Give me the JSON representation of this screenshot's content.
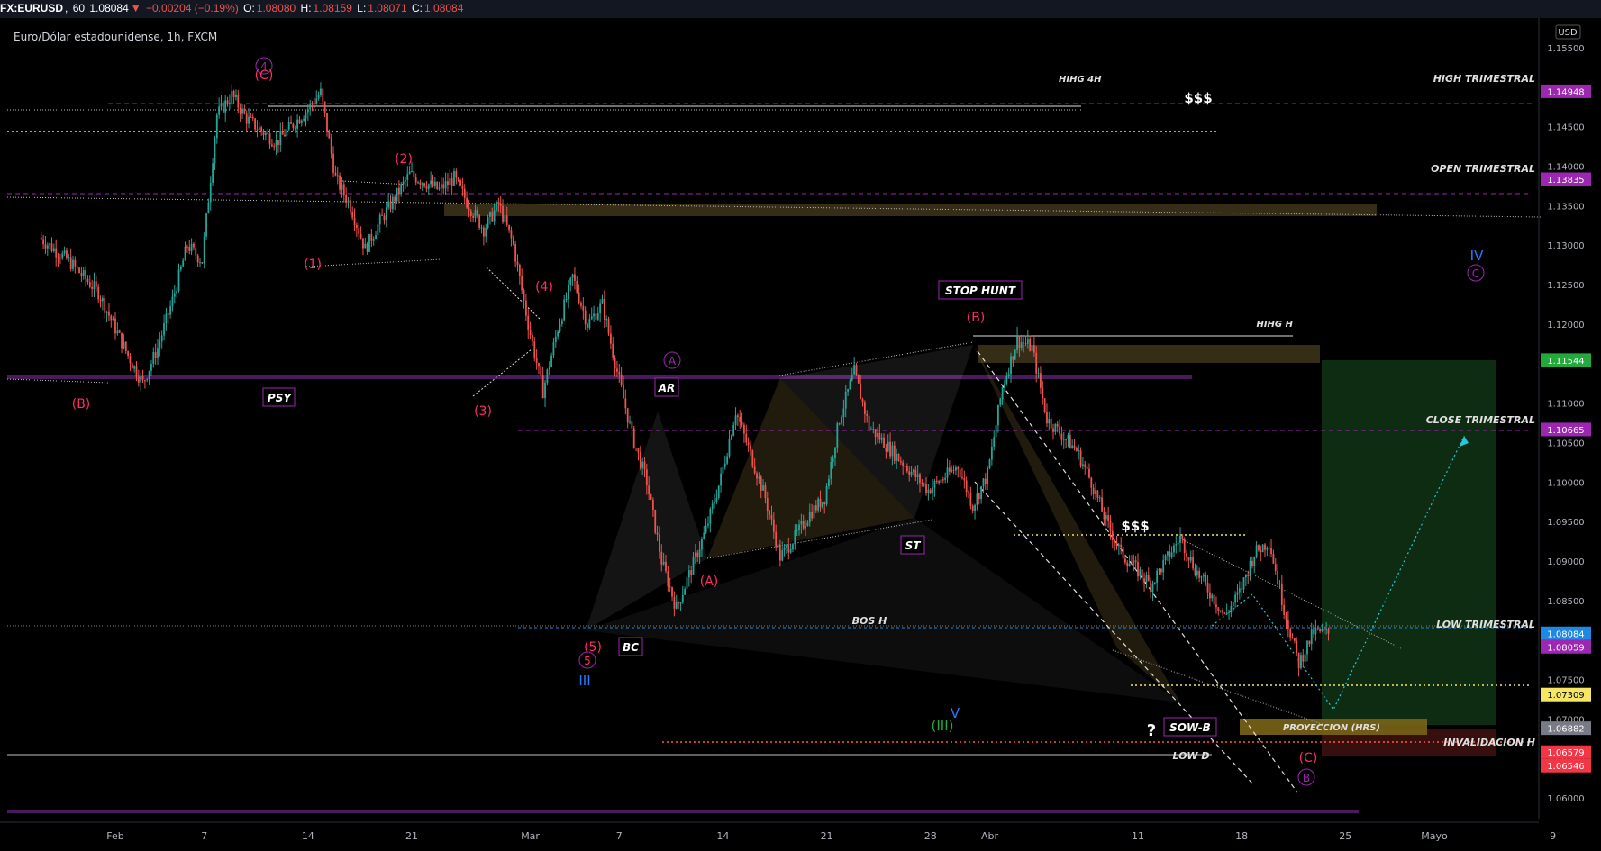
{
  "header": {
    "symbol": "FX:EURUSD",
    "interval": "60",
    "last": "1.08084",
    "change": "−0.00204 (−0.19%)",
    "o_label": "O:",
    "o": "1.08080",
    "h_label": "H:",
    "h": "1.08159",
    "l_label": "L:",
    "l": "1.08071",
    "c_label": "C:",
    "c": "1.08084",
    "subtitle": "Euro/Dólar estadounidense, 1h, FXCM",
    "currency": "USD"
  },
  "colors": {
    "up": "#26a69a",
    "down": "#ef5350",
    "magenta": "#9c27b0",
    "wave_red": "#ff2e63",
    "yellow": "#f5e663",
    "white": "#e0e0e0",
    "bg": "#000000",
    "axis_bg": "#000000"
  },
  "chart_data": {
    "type": "candlestick",
    "title": "Euro/Dólar estadounidense, 1h, FXCM",
    "y_axis": {
      "range": [
        1.055,
        1.158
      ],
      "ticks": [
        "1.15500",
        "1.15000",
        "1.14500",
        "1.14000",
        "1.13500",
        "1.13000",
        "1.12500",
        "1.12000",
        "1.11500",
        "1.11000",
        "1.10500",
        "1.10000",
        "1.09500",
        "1.09000",
        "1.08500",
        "1.08000",
        "1.07500",
        "1.07000",
        "1.06500",
        "1.06000"
      ],
      "tick_values": [
        1.155,
        1.15,
        1.145,
        1.14,
        1.135,
        1.13,
        1.125,
        1.12,
        1.115,
        1.11,
        1.105,
        1.1,
        1.095,
        1.09,
        1.085,
        1.08,
        1.075,
        1.07,
        1.065,
        1.06
      ]
    },
    "x_axis": {
      "range": [
        "2025-01-27",
        "2025-05-10"
      ],
      "ticks": [
        {
          "label": "Feb",
          "date": "2025-02-01"
        },
        {
          "label": "7",
          "date": "2025-02-07"
        },
        {
          "label": "14",
          "date": "2025-02-14"
        },
        {
          "label": "21",
          "date": "2025-02-21"
        },
        {
          "label": "Mar",
          "date": "2025-03-01"
        },
        {
          "label": "7",
          "date": "2025-03-07"
        },
        {
          "label": "14",
          "date": "2025-03-14"
        },
        {
          "label": "21",
          "date": "2025-03-21"
        },
        {
          "label": "28",
          "date": "2025-03-28"
        },
        {
          "label": "Abr",
          "date": "2025-04-01"
        },
        {
          "label": "11",
          "date": "2025-04-11"
        },
        {
          "label": "18",
          "date": "2025-04-18"
        },
        {
          "label": "25",
          "date": "2025-04-25"
        },
        {
          "label": "Mayo",
          "date": "2025-05-01"
        },
        {
          "label": "9",
          "date": "2025-05-09"
        }
      ]
    },
    "price_path": [
      [
        "2025-01-27",
        1.131
      ],
      [
        "2025-01-29",
        1.128
      ],
      [
        "2025-01-31",
        1.124
      ],
      [
        "2025-02-02",
        1.116
      ],
      [
        "2025-02-03",
        1.1125
      ],
      [
        "2025-02-04",
        1.117
      ],
      [
        "2025-02-05",
        1.123
      ],
      [
        "2025-02-06",
        1.13
      ],
      [
        "2025-02-07",
        1.128
      ],
      [
        "2025-02-08",
        1.1465
      ],
      [
        "2025-02-09",
        1.149
      ],
      [
        "2025-02-10",
        1.146
      ],
      [
        "2025-02-12",
        1.143
      ],
      [
        "2025-02-14",
        1.147
      ],
      [
        "2025-02-15",
        1.1493
      ],
      [
        "2025-02-16",
        1.1385
      ],
      [
        "2025-02-17",
        1.135
      ],
      [
        "2025-02-18",
        1.1295
      ],
      [
        "2025-02-19",
        1.133
      ],
      [
        "2025-02-21",
        1.139
      ],
      [
        "2025-02-23",
        1.137
      ],
      [
        "2025-02-24",
        1.1385
      ],
      [
        "2025-02-25",
        1.135
      ],
      [
        "2025-02-26",
        1.132
      ],
      [
        "2025-02-27",
        1.1352
      ],
      [
        "2025-02-28",
        1.13
      ],
      [
        "2025-03-01",
        1.12
      ],
      [
        "2025-03-02",
        1.1115
      ],
      [
        "2025-03-03",
        1.1195
      ],
      [
        "2025-03-04",
        1.126
      ],
      [
        "2025-03-05",
        1.12
      ],
      [
        "2025-03-06",
        1.1225
      ],
      [
        "2025-03-07",
        1.114
      ],
      [
        "2025-03-08",
        1.106
      ],
      [
        "2025-03-09",
        1.1
      ],
      [
        "2025-03-10",
        1.09
      ],
      [
        "2025-03-11",
        1.084
      ],
      [
        "2025-03-12",
        1.089
      ],
      [
        "2025-03-13",
        1.094
      ],
      [
        "2025-03-14",
        1.1005
      ],
      [
        "2025-03-15",
        1.109
      ],
      [
        "2025-03-16",
        1.1035
      ],
      [
        "2025-03-17",
        1.098
      ],
      [
        "2025-03-18",
        1.0905
      ],
      [
        "2025-03-19",
        1.093
      ],
      [
        "2025-03-20",
        1.096
      ],
      [
        "2025-03-21",
        1.098
      ],
      [
        "2025-03-22",
        1.108
      ],
      [
        "2025-03-23",
        1.114
      ],
      [
        "2025-03-24",
        1.107
      ],
      [
        "2025-03-26",
        1.103
      ],
      [
        "2025-03-28",
        1.099
      ],
      [
        "2025-03-30",
        1.102
      ],
      [
        "2025-03-31",
        1.097
      ],
      [
        "2025-04-01",
        1.101
      ],
      [
        "2025-04-02",
        1.112
      ],
      [
        "2025-04-03",
        1.118
      ],
      [
        "2025-04-04",
        1.117
      ],
      [
        "2025-04-05",
        1.108
      ],
      [
        "2025-04-07",
        1.104
      ],
      [
        "2025-04-08",
        1.1
      ],
      [
        "2025-04-09",
        1.095
      ],
      [
        "2025-04-10",
        1.091
      ],
      [
        "2025-04-12",
        1.087
      ],
      [
        "2025-04-14",
        1.093
      ],
      [
        "2025-04-15",
        1.089
      ],
      [
        "2025-04-16",
        1.086
      ],
      [
        "2025-04-17",
        1.083
      ],
      [
        "2025-04-18",
        1.086
      ],
      [
        "2025-04-19",
        1.091
      ],
      [
        "2025-04-20",
        1.0925
      ],
      [
        "2025-04-21",
        1.084
      ],
      [
        "2025-04-22",
        1.077
      ],
      [
        "2025-04-23",
        1.081
      ],
      [
        "2025-04-24",
        1.0808
      ]
    ],
    "price_labels": [
      {
        "text": "1.14948",
        "value": 1.14948,
        "bg": "#9c27b0",
        "fg": "#ffffff"
      },
      {
        "text": "1.13835",
        "value": 1.13835,
        "bg": "#9c27b0",
        "fg": "#ffffff"
      },
      {
        "text": "1.11544",
        "value": 1.11544,
        "bg": "#22ab3a",
        "fg": "#ffffff"
      },
      {
        "text": "1.10665",
        "value": 1.10665,
        "bg": "#9c27b0",
        "fg": "#ffffff"
      },
      {
        "text": "1.08084",
        "value": 1.08084,
        "bg": "#1e88e5",
        "fg": "#ffffff"
      },
      {
        "text": "1.08059",
        "value": 1.08059,
        "bg": "#9c27b0",
        "fg": "#ffffff"
      },
      {
        "text": "1.07309",
        "value": 1.07309,
        "bg": "#f5e663",
        "fg": "#000000"
      },
      {
        "text": "1.06882",
        "value": 1.06882,
        "bg": "#787b86",
        "fg": "#ffffff"
      },
      {
        "text": "1.06579",
        "value": 1.06579,
        "bg": "#f23645",
        "fg": "#ffffff"
      },
      {
        "text": "1.06546",
        "value": 1.06546,
        "bg": "#f23645",
        "fg": "#ffffff"
      }
    ],
    "horizontal_labels": [
      {
        "text": "HIHG 4H",
        "value": 1.1497
      },
      {
        "text": "HIGH TRIMESTRAL",
        "value": 1.1497
      },
      {
        "text": "OPEN TRIMESTRAL",
        "value": 1.1386
      },
      {
        "text": "HIHG H",
        "value": 1.1192
      },
      {
        "text": "CLOSE TRIMESTRAL",
        "value": 1.1067
      },
      {
        "text": "BOS H",
        "value": 1.0806
      },
      {
        "text": "LOW TRIMESTRAL",
        "value": 1.0806
      },
      {
        "text": "PROYECCION (HRS)",
        "value": 1.0688
      },
      {
        "text": "INVALIDACION H",
        "value": 1.0658
      },
      {
        "text": "LOW D",
        "value": 1.0644
      }
    ],
    "boxed_labels": [
      "PSY",
      "AR",
      "STOP HUNT",
      "ST",
      "BC",
      "SOW-B"
    ],
    "liquidity_labels": [
      "$$$",
      "$$$"
    ],
    "wave_labels": [
      "4",
      "(C)",
      "(B)",
      "(1)",
      "(2)",
      "(3)",
      "(4)",
      "(5)",
      "5",
      "III",
      "(A)",
      "A",
      "(B)",
      "(III)",
      "V",
      "(C)",
      "B",
      "IV",
      "C",
      "?"
    ]
  }
}
